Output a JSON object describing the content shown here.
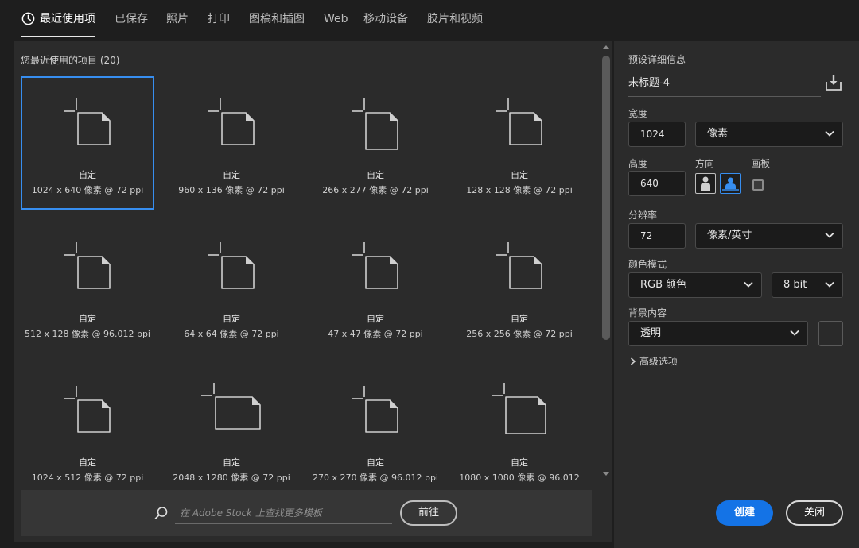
{
  "tabs": [
    {
      "label": "最近使用项",
      "active": true
    },
    {
      "label": "已保存"
    },
    {
      "label": "照片"
    },
    {
      "label": "打印"
    },
    {
      "label": "图稿和插图"
    },
    {
      "label": "Web"
    },
    {
      "label": "移动设备"
    },
    {
      "label": "胶片和视频"
    }
  ],
  "recent": {
    "title": "您最近使用的项目 (20)",
    "items": [
      {
        "name": "自定",
        "size": "1024 x 640 像素 @ 72 ppi",
        "selected": true
      },
      {
        "name": "自定",
        "size": "960 x 136 像素 @ 72 ppi"
      },
      {
        "name": "自定",
        "size": "266 x 277 像素 @ 72 ppi"
      },
      {
        "name": "自定",
        "size": "128 x 128 像素 @ 72 ppi"
      },
      {
        "name": "自定",
        "size": "512 x 128 像素 @ 96.012 ppi"
      },
      {
        "name": "自定",
        "size": "64 x 64 像素 @ 72 ppi"
      },
      {
        "name": "自定",
        "size": "47 x 47 像素 @ 72 ppi"
      },
      {
        "name": "自定",
        "size": "256 x 256 像素 @ 72 ppi"
      },
      {
        "name": "自定",
        "size": "1024 x 512 像素 @ 72 ppi"
      },
      {
        "name": "自定",
        "size": "2048 x 1280 像素 @ 72 ppi"
      },
      {
        "name": "自定",
        "size": "270 x 270 像素 @ 96.012 ppi"
      },
      {
        "name": "自定",
        "size": "1080 x 1080 像素 @ 96.012"
      }
    ]
  },
  "stock": {
    "placeholder": "在 Adobe Stock 上查找更多模板",
    "go_label": "前往"
  },
  "preset": {
    "section_label": "预设详细信息",
    "doc_name": "未标题-4",
    "width_label": "宽度",
    "width_value": "1024",
    "width_unit": "像素",
    "height_label": "高度",
    "height_value": "640",
    "orientation_label": "方向",
    "artboard_label": "画板",
    "resolution_label": "分辨率",
    "resolution_value": "72",
    "resolution_unit": "像素/英寸",
    "color_mode_label": "颜色模式",
    "color_mode": "RGB 颜色",
    "bit_depth": "8 bit",
    "background_label": "背景内容",
    "background": "透明",
    "advanced_label": "高级选项"
  },
  "buttons": {
    "create": "创建",
    "close": "关闭"
  },
  "colors": {
    "accent": "#378ef0",
    "primary_button": "#1473e6",
    "panel": "#2b2b2b",
    "background": "#1e1e1e"
  }
}
